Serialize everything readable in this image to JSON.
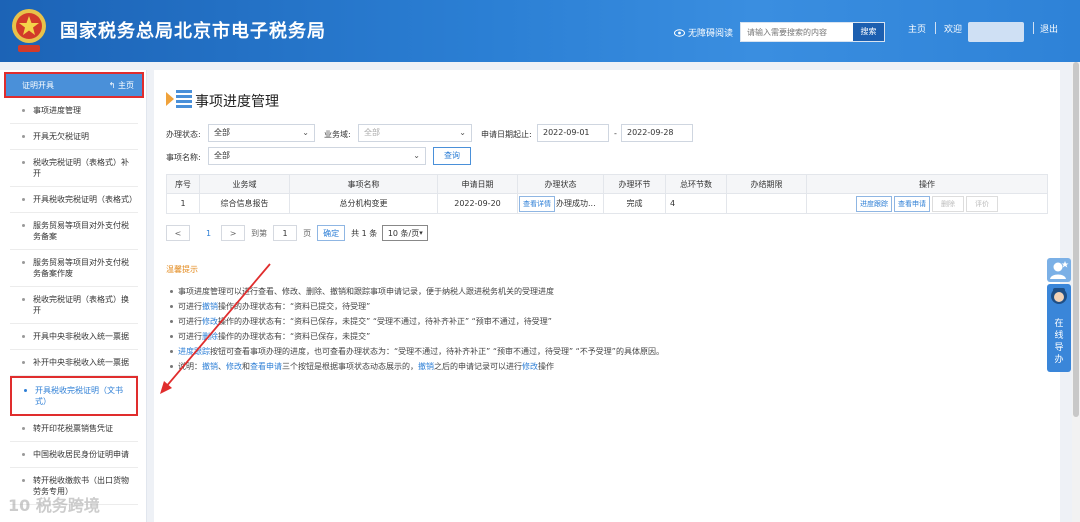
{
  "header": {
    "title": "国家税务总局北京市电子税务局",
    "a11y_label": "无障碍阅读",
    "search_placeholder": "请输入需要搜索的内容",
    "search_label": "搜索",
    "home_label": "主页",
    "welcome_label": "欢迎",
    "logout_label": "退出",
    "brand_color": "#2b7fd4",
    "icons": [
      "tax-emblem",
      "eye-icon"
    ]
  },
  "sidebar": {
    "head_title": "证明开具",
    "head_home": "主页",
    "items": [
      {
        "label": "事项进度管理"
      },
      {
        "label": "开具无欠税证明"
      },
      {
        "label": "税收完税证明（表格式）补开"
      },
      {
        "label": "开具税收完税证明（表格式）"
      },
      {
        "label": "服务贸易等项目对外支付税务备案"
      },
      {
        "label": "服务贸易等项目对外支付税务备案作废"
      },
      {
        "label": "税收完税证明（表格式）换开"
      },
      {
        "label": "开具中央非税收入统一票据"
      },
      {
        "label": "补开中央非税收入统一票据"
      },
      {
        "label": "开具税收完税证明（文书式）"
      },
      {
        "label": "转开印花税票销售凭证"
      },
      {
        "label": "中国税收居民身份证明申请"
      },
      {
        "label": "转开税收缴款书（出口货物劳务专用）"
      }
    ],
    "active_index": 9
  },
  "main": {
    "page_title": "事项进度管理",
    "filters": {
      "status_label": "办理状态:",
      "status_value": "全部",
      "domain_label": "业务域:",
      "domain_value": "全部",
      "date_label": "申请日期起止:",
      "date_from": "2022-09-01",
      "date_sep": "-",
      "date_to": "2022-09-28",
      "name_label": "事项名称:",
      "name_value": "全部",
      "query_label": "查询"
    },
    "table": {
      "headers": [
        "序号",
        "业务域",
        "事项名称",
        "申请日期",
        "办理状态",
        "办理环节",
        "总环节数",
        "办结期限",
        "操作"
      ],
      "rows": [
        {
          "index": "1",
          "domain": "综合信息报告",
          "name": "总分机构变更",
          "date": "2022-09-20",
          "detail_btn": "查看详情",
          "status": "办理成功...",
          "stage": "完成",
          "total": "4",
          "deadline": "",
          "ops": [
            "进度跟踪",
            "查看申请",
            "删除",
            "评价"
          ]
        }
      ]
    },
    "pager": {
      "prev": "<",
      "current": "1",
      "next": ">",
      "goto_label": "到第",
      "goto_value": "1",
      "page_unit": "页",
      "confirm": "确定",
      "total_text": "共 1 条",
      "page_size": "10 条/页"
    },
    "tips": {
      "title": "温馨提示",
      "items": [
        {
          "parts": [
            "事项进度管理可以进行查看、修改、删除、撤销和跟踪事项申请记录，便于纳税人跟进税务机关的受理进度"
          ]
        },
        {
          "parts": [
            "可进行",
            "撤销",
            "操作的办理状态有：“资料已提交，待受理”"
          ]
        },
        {
          "parts": [
            "可进行",
            "修改",
            "操作的办理状态有：“资料已保存，未提交”  “受理不通过，待补齐补正”  “预审不通过，待受理”"
          ]
        },
        {
          "parts": [
            "可进行",
            "删除",
            "操作的办理状态有：“资料已保存，未提交”"
          ]
        },
        {
          "parts": [
            "进度跟踪",
            "按钮可查看事项办理的进度，也可查看办理状态为：“受理不通过，待补齐补正”  “预审不通过，待受理”  “不予受理”的具体原因。"
          ]
        },
        {
          "parts": [
            "说明：",
            "撤销",
            "、",
            "修改",
            "和",
            "查看申请",
            "三个按钮是根据事项状态动态展示的，",
            "撤销",
            "之后的申请记录可以进行",
            "修改",
            "操作"
          ]
        }
      ]
    }
  },
  "float": {
    "tab_text": "在线导办",
    "icons": [
      "user-avatar-icon"
    ]
  },
  "watermark": "10 税务跨境"
}
